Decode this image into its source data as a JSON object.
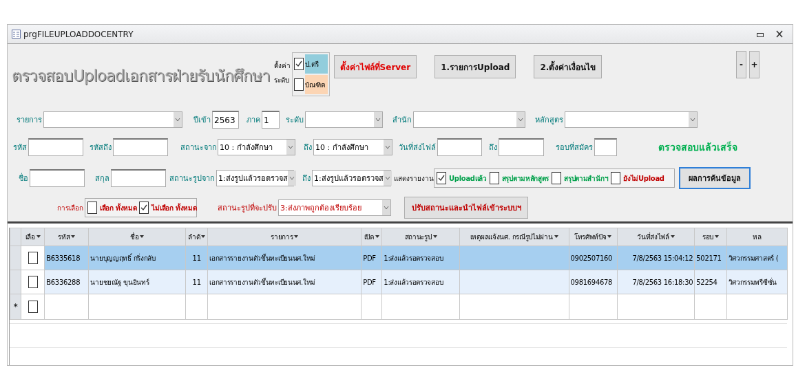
{
  "window": {
    "title": "prgFILEUPLOADDOCENTRY"
  },
  "header": {
    "title": "ตรวจสอบUploadเอกสารฝ่ายรับนักศึกษา",
    "level_label": [
      "ตั้งค่า",
      "ระดับ"
    ],
    "level_options": [
      {
        "label": "ป.ตรี",
        "checked": true,
        "color": "#92cddc"
      },
      {
        "label": "บัณฑิต",
        "checked": false,
        "color": "#fcd5b4"
      }
    ],
    "buttons": [
      {
        "label": "ตั้งค่าไฟล์ที่Server",
        "kind": "alert"
      },
      {
        "label": "1.รายการUpload",
        "kind": "bold"
      },
      {
        "label": "2.ตั้งค่าเงื่อนไข",
        "kind": "bold"
      }
    ],
    "zoom_buttons": [
      "-",
      "+"
    ]
  },
  "filter_rows": [
    [
      {
        "kind": "combo",
        "label": "รายการ"
      },
      {
        "kind": "text",
        "label": "ปีเข้า",
        "value": "2563"
      },
      {
        "kind": "text",
        "label": "ภาค",
        "value": "1"
      },
      {
        "kind": "combo",
        "label": "ระดับ"
      },
      {
        "kind": "combo",
        "label": "สำนัก"
      },
      {
        "kind": "combo",
        "label": "หลักสูตร"
      }
    ],
    [
      {
        "kind": "text",
        "label": "รหัส"
      },
      {
        "kind": "text",
        "label": "รหัสถึง"
      },
      {
        "kind": "combo",
        "label": "สถานะจาก",
        "value": "10 : กำลังศึกษา"
      },
      {
        "kind": "combo",
        "label": "ถึง",
        "value": "10 : กำลังศึกษา"
      },
      {
        "kind": "text",
        "label": "วันที่ส่งไฟล์"
      },
      {
        "kind": "text",
        "label": "ถึง"
      },
      {
        "kind": "text",
        "label": "รอบที่สมัคร"
      },
      {
        "kind": "status",
        "label": "ตรวจสอบแล้วเสร็จ"
      }
    ],
    [
      {
        "kind": "text",
        "label": "ชื่อ"
      },
      {
        "kind": "text",
        "label": "สกุล"
      },
      {
        "kind": "combo",
        "label": "สถานะรูปจาก",
        "value": "1:ส่งรูปแล้วรอตรวจส"
      },
      {
        "kind": "combo",
        "label": "ถึง",
        "value": "1:ส่งรูปแล้วรอตรวจส"
      },
      {
        "kind": "checks",
        "label": "แสดงรายงาน",
        "options": [
          {
            "label": "Uploadแล้ว",
            "checked": true,
            "color": "#00a04a"
          },
          {
            "label": "สรุปตามหลักสูตร",
            "checked": false,
            "color": "#00a04a"
          },
          {
            "label": "สรุปตามสำนักฯ",
            "checked": false,
            "color": "#00a04a"
          },
          {
            "label": "ยังไม่Upload",
            "checked": false,
            "color": "#c00000"
          }
        ]
      },
      {
        "kind": "button",
        "label": "ผลการค้นข้อมูล",
        "focused": true
      }
    ],
    [
      {
        "kind": "checks",
        "label": "การเลือก",
        "alert": true,
        "options": [
          {
            "label": "เลือก ทั้งหมด",
            "checked": false,
            "color": "#c00000"
          },
          {
            "label": "ไม่เลือก ทั้งหมด",
            "checked": true,
            "color": "#c00000"
          }
        ]
      },
      {
        "kind": "combo",
        "label": "สถานะรูปที่จะปรับ",
        "value": "3:ส่งภาพถูกต้องเรียบร้อย",
        "alert": true
      },
      {
        "kind": "button",
        "label": "ปรับสถานะและนำไฟล์เข้าระบบฯ",
        "alert": true
      }
    ]
  ],
  "table": {
    "select_column": "เลือ",
    "columns": [
      "รหัส",
      "ชื่อ",
      "ลำดั",
      "รายการ",
      "เปิด",
      "สถานะรูป",
      "เหตุผลแจ้งนศ. กรณีรูปไม่ผ่าน",
      "โทรศัพท์ปัจ",
      "วันที่ส่งไฟล์",
      "รอบ",
      "หล"
    ],
    "rows": [
      {
        "selected": true,
        "checked": false,
        "cells": [
          "B6335618",
          "นายบุญญฤทธิ์  กริ่งกลับ",
          "11",
          "เอกสารรายงานตัวขึ้นทะเบียนนศ.ใหม่",
          "PDF",
          "1:ส่งแล้วรอตรวจสอบ",
          "",
          "0902507160",
          "7/8/2563 15:04:12",
          "502171",
          "วิศวกรรมศาสตร์ ("
        ]
      },
      {
        "selected": false,
        "checked": false,
        "cells": [
          "B6336288",
          "นายชยณัฐ  ขุนอินทร์",
          "11",
          "เอกสารรายงานตัวขึ้นทะเบียนนศ.ใหม่",
          "PDF",
          "1:ส่งแล้วรอตรวจสอบ",
          "",
          "0981694678",
          "7/8/2563 16:18:30",
          "52254",
          "วิศวกรรมพรีซีซั่น"
        ]
      }
    ],
    "new_row": {
      "marker": "*",
      "checked": false
    }
  }
}
